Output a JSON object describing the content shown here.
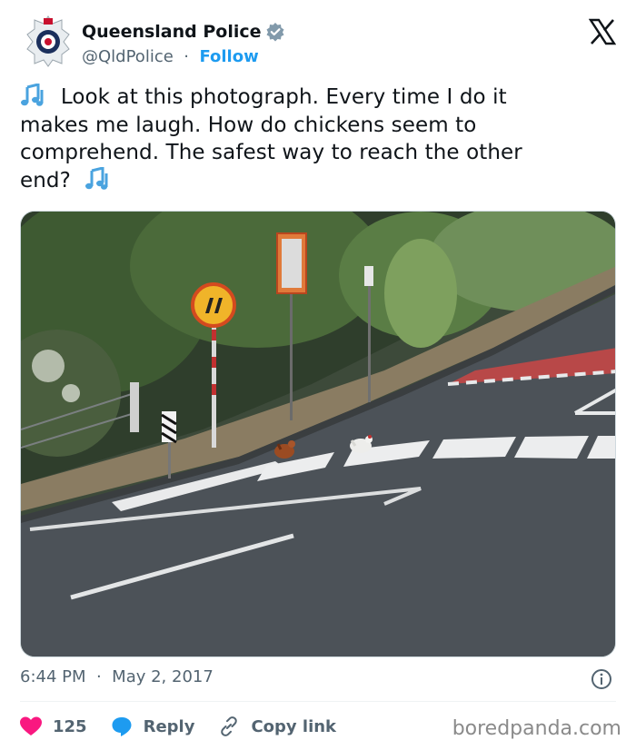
{
  "author": {
    "name": "Queensland Police",
    "handle": "@QldPolice",
    "separator": "·",
    "follow_label": "Follow"
  },
  "tweet": {
    "line1": "Look at this photograph. Every time I do it",
    "line2": "makes me laugh. How do chickens seem to",
    "line3": "comprehend. The safest way to reach the other",
    "line4": "end?"
  },
  "meta": {
    "time": "6:44 PM",
    "separator": "·",
    "date": "May 2, 2017"
  },
  "actions": {
    "like_count": "125",
    "reply_label": "Reply",
    "copy_link_label": "Copy link"
  },
  "watermark": "boredpanda.com",
  "colors": {
    "accent": "#1d9bf0",
    "like": "#f91880",
    "muted": "#536471",
    "text": "#0f1419"
  },
  "icons": [
    "police-badge-avatar",
    "verified-badge-icon",
    "x-logo-icon",
    "musical-notes-icon",
    "info-icon",
    "heart-icon",
    "reply-bubble-icon",
    "link-icon"
  ]
}
